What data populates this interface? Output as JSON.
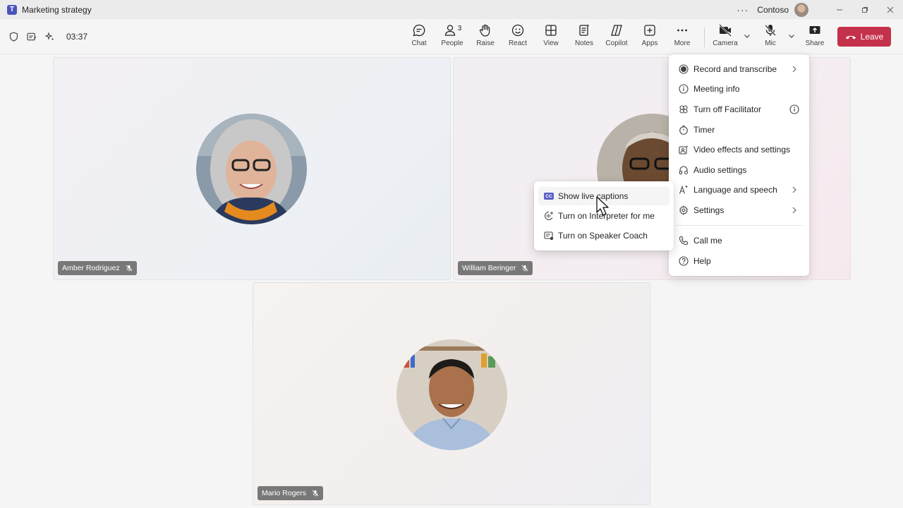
{
  "window": {
    "title": "Marketing strategy",
    "org": "Contoso",
    "app_icon_letter": "T"
  },
  "meeting": {
    "timer": "03:37"
  },
  "toolbar": {
    "chat": "Chat",
    "people": "People",
    "people_count": "3",
    "raise": "Raise",
    "react": "React",
    "view": "View",
    "notes": "Notes",
    "copilot": "Copilot",
    "apps": "Apps",
    "more": "More",
    "camera": "Camera",
    "mic": "Mic",
    "share": "Share",
    "leave": "Leave"
  },
  "participants": [
    {
      "name": "Amber Rodriguez",
      "muted": true
    },
    {
      "name": "William Beringer",
      "muted": true
    },
    {
      "name": "Mario Rogers",
      "muted": true
    }
  ],
  "more_menu": {
    "items": [
      {
        "label": "Record and transcribe",
        "icon": "record-icon",
        "has_submenu": true
      },
      {
        "label": "Meeting info",
        "icon": "info-icon"
      },
      {
        "label": "Turn off Facilitator",
        "icon": "facilitator-icon",
        "trailing": "info-icon"
      },
      {
        "label": "Timer",
        "icon": "timer-icon"
      },
      {
        "label": "Video effects and settings",
        "icon": "video-effects-icon"
      },
      {
        "label": "Audio settings",
        "icon": "audio-settings-icon"
      },
      {
        "label": "Language and speech",
        "icon": "language-icon",
        "has_submenu": true
      },
      {
        "label": "Settings",
        "icon": "gear-icon",
        "has_submenu": true
      },
      {
        "label": "Call me",
        "icon": "phone-icon"
      },
      {
        "label": "Help",
        "icon": "help-icon"
      }
    ]
  },
  "language_submenu": {
    "items": [
      {
        "label": "Show live captions",
        "icon": "cc-icon",
        "badge": "CC",
        "hovered": true
      },
      {
        "label": "Turn on Interpreter for me",
        "icon": "interpreter-icon"
      },
      {
        "label": "Turn on Speaker Coach",
        "icon": "speaker-coach-icon"
      }
    ]
  },
  "colors": {
    "accent": "#5b5fc7",
    "leave": "#c4314b"
  }
}
